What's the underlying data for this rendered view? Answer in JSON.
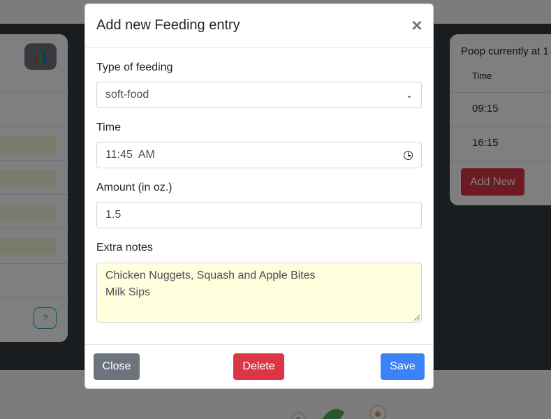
{
  "background": {
    "right_card": {
      "title": "Poop currently at 1",
      "column_header": "Time",
      "rows": [
        "09:15",
        "16:15"
      ],
      "add_button": "Add New"
    },
    "help_button": "?"
  },
  "modal": {
    "title": "Add new Feeding entry",
    "close_icon": "×",
    "type_label": "Type of feeding",
    "type_value": "soft-food",
    "time_label": "Time",
    "time_value": "11:45  AM",
    "amount_label": "Amount (in oz.)",
    "amount_value": "1.5",
    "notes_label": "Extra notes",
    "notes_line1": "Chicken Nuggets, Squash and Apple Bites",
    "notes_line2": "Milk Sips",
    "buttons": {
      "close": "Close",
      "delete": "Delete",
      "save": "Save"
    }
  },
  "colors": {
    "danger": "#dc3545",
    "primary": "#3b82f6",
    "secondary": "#6c757d",
    "notes_bg": "#fffedd"
  },
  "icons": [
    "bar-chart-icon",
    "clock-icon",
    "chevron-down-icon",
    "close-icon",
    "flower-icon",
    "leaf-icon"
  ]
}
